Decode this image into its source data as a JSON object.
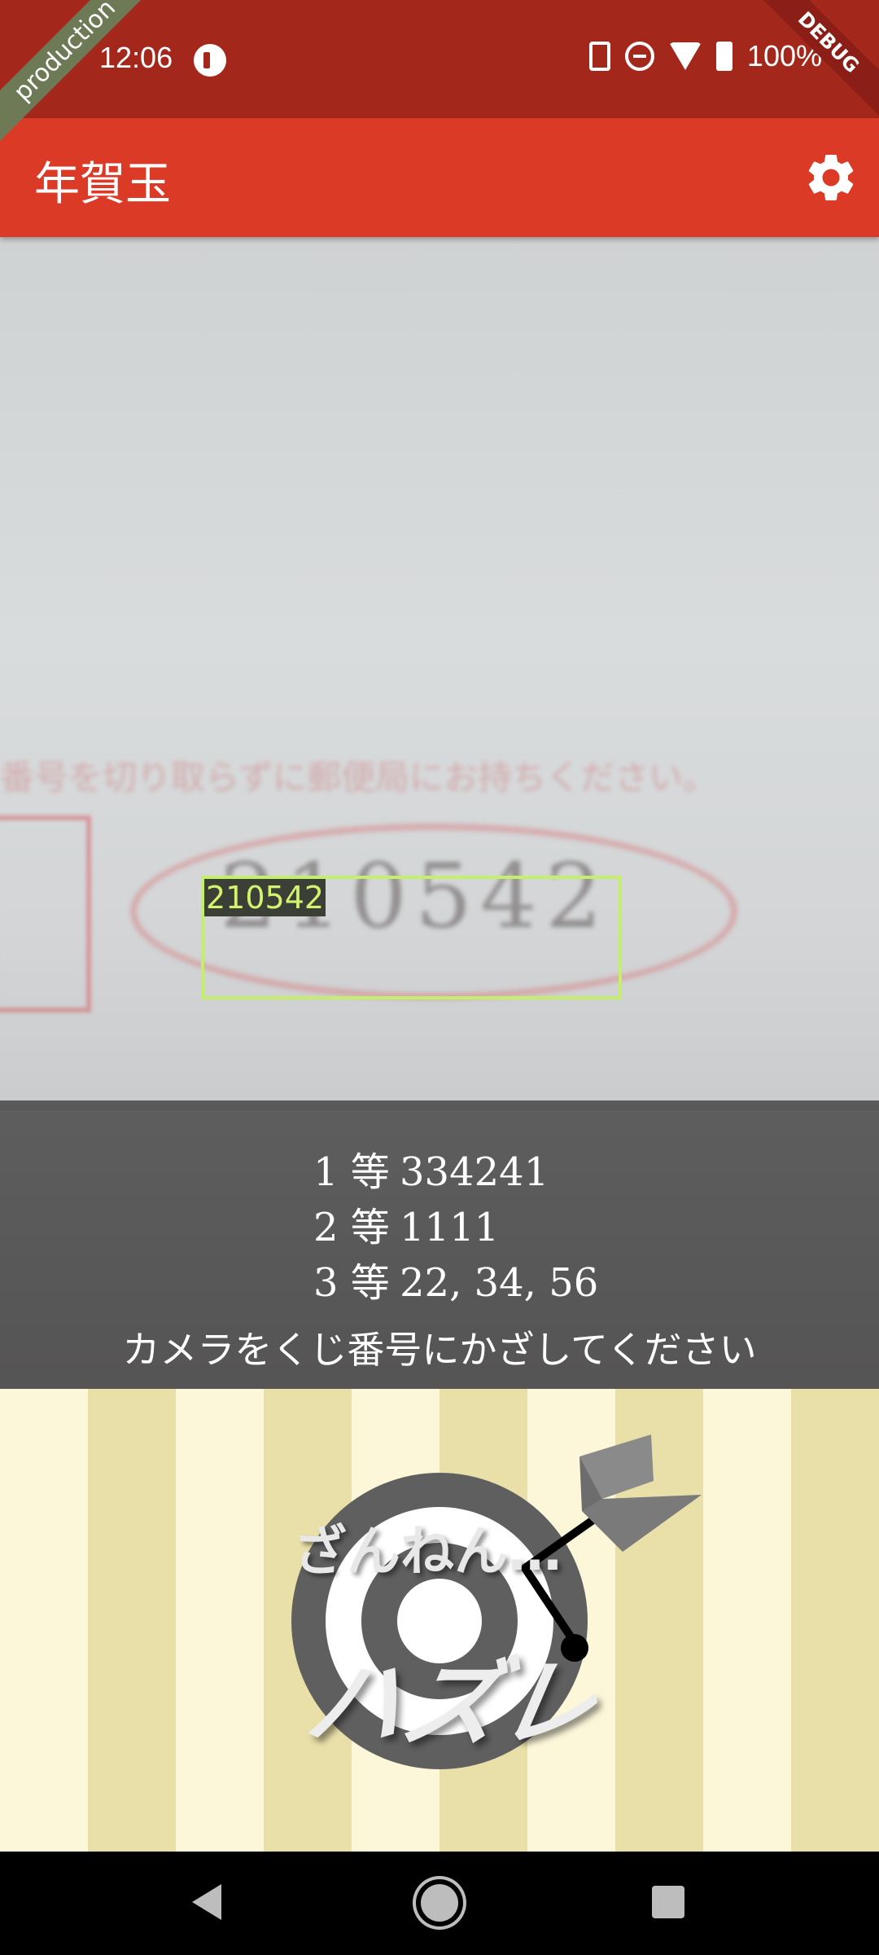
{
  "status_bar": {
    "time": "12:06",
    "battery": "100%",
    "icons": [
      "app-notification-icon",
      "vibrate-icon",
      "do-not-disturb-icon",
      "wifi-icon",
      "battery-charging-icon"
    ]
  },
  "ribbons": {
    "left": "production",
    "right": "DEBUG"
  },
  "app_bar": {
    "title": "年賀玉",
    "settings_icon": "gear-icon",
    "color": "#db3a26"
  },
  "camera": {
    "background_ticket_text": "番号を切り取らずに郵便局にお持ちください。",
    "background_ticket_number": "210542",
    "detected_number": "210542",
    "detection_color": "#c5ef6a"
  },
  "prizes": [
    {
      "rank": "1 等",
      "numbers": "334241"
    },
    {
      "rank": "2 等",
      "numbers": "1111"
    },
    {
      "rank": "3 等",
      "numbers": "22, 34, 56"
    }
  ],
  "instruction": "カメラをくじ番号にかざしてください",
  "result": {
    "line1": "ざんねん…",
    "line2": "ハズレ",
    "icon": "dartboard-miss-icon"
  },
  "nav_bar": {
    "icons": [
      "back-icon",
      "home-icon",
      "recents-icon"
    ]
  }
}
